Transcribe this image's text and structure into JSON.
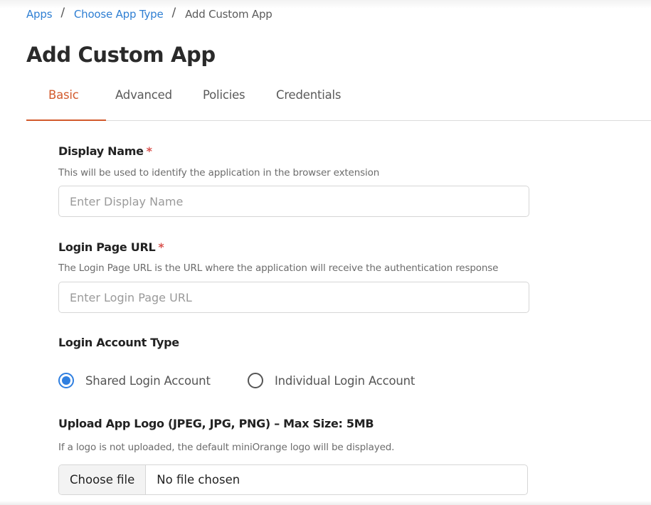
{
  "breadcrumb": {
    "items": [
      {
        "label": "Apps"
      },
      {
        "label": "Choose App Type"
      },
      {
        "label": "Add Custom App"
      }
    ],
    "separator": "/"
  },
  "page": {
    "title": "Add Custom App"
  },
  "tabs": [
    {
      "label": "Basic",
      "active": true
    },
    {
      "label": "Advanced",
      "active": false
    },
    {
      "label": "Policies",
      "active": false
    },
    {
      "label": "Credentials",
      "active": false
    }
  ],
  "form": {
    "display_name": {
      "label": "Display Name",
      "required_mark": "*",
      "help": "This will be used to identify the application in the browser extension",
      "placeholder": "Enter Display Name",
      "value": ""
    },
    "login_url": {
      "label": "Login Page URL",
      "required_mark": "*",
      "help": "The Login Page URL is the URL where the application will receive the authentication response",
      "placeholder": "Enter Login Page URL",
      "value": ""
    },
    "account_type": {
      "label": "Login Account Type",
      "options": [
        {
          "label": "Shared Login Account",
          "selected": true
        },
        {
          "label": "Individual Login Account",
          "selected": false
        }
      ]
    },
    "logo": {
      "label": "Upload App Logo (JPEG, JPG, PNG) – Max Size: 5MB",
      "help": "If a logo is not uploaded, the default miniOrange logo will be displayed.",
      "button_label": "Choose file",
      "status": "No file chosen"
    }
  },
  "colors": {
    "link": "#2f7fd3",
    "accent": "#d25a2c",
    "radio_selected": "#2f7fe0",
    "required": "#d9534f"
  }
}
